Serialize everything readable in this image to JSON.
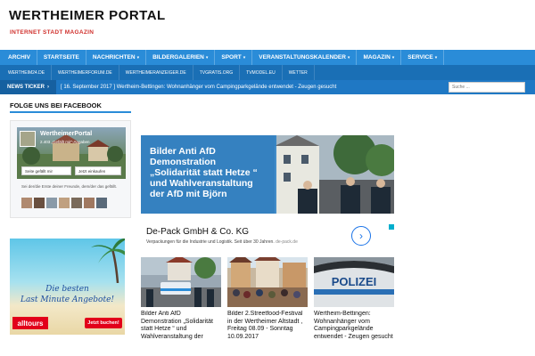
{
  "site": {
    "title": "WERTHEIMER PORTAL",
    "tagline": "INTERNET STADT MAGAZIN"
  },
  "main_nav": {
    "items": [
      {
        "label": "ARCHIV",
        "has_dropdown": false
      },
      {
        "label": "STARTSEITE",
        "has_dropdown": false
      },
      {
        "label": "NACHRICHTEN",
        "has_dropdown": true
      },
      {
        "label": "BILDERGALERIEN",
        "has_dropdown": true
      },
      {
        "label": "SPORT",
        "has_dropdown": true
      },
      {
        "label": "VERANSTALTUNGSKALENDER",
        "has_dropdown": true
      },
      {
        "label": "MAGAZIN",
        "has_dropdown": true
      },
      {
        "label": "SERVICE",
        "has_dropdown": true
      }
    ],
    "dropdown_icon": "chevron-down-icon"
  },
  "sub_nav": {
    "items": [
      "WERTHEIM24.DE",
      "WERTHEIMERFORUM.DE",
      "WERTHEIMERANZEIGER.DE",
      "TVGRATIS.ORG",
      "TVMODEL.EU",
      "WETTER"
    ]
  },
  "ticker": {
    "label": "NEWS TICKER",
    "arrow": "›",
    "date": "[ 16. September 2017 ]",
    "headline": "Wertheim-Bettingen: Wohnanhänger vom Campingparkgelände entwendet - Zeugen gesucht",
    "search_placeholder": "Suche ..."
  },
  "sidebar": {
    "facebook_title": "FOLGE UNS BEI FACEBOOK",
    "facebook": {
      "page_name": "WertheimerPortal",
      "likes_text": "2.403 „Gefällt mir“-Angaben",
      "like_button": "Seite gefällt mir",
      "share_button": "Jetzt einkaufen",
      "friends_text": "Sei der/die Erste deiner Freunde, dem/der das gefällt."
    },
    "ad": {
      "headline_line1": "Die besten",
      "headline_line2": "Last Minute Angebote!",
      "logo_text": "alltours",
      "cta_label": "Jetzt buchen!"
    }
  },
  "hero": {
    "caption": "Bilder Anti AfD Demonstration „Solidarität statt Hetze “ und Wahlveranstaltung der AfD mit Björn"
  },
  "text_ad": {
    "title": "De-Pack GmbH & Co. KG",
    "description": "Verpackungen für die Industrie und Logistik. Seit über 30 Jahren.",
    "url": "de-pack.de",
    "go_icon": "›"
  },
  "cards": [
    {
      "title": "Bilder Anti AfD Demonstration „Solidarität statt Hetze “ und Wahlveranstaltung der",
      "image": "police-demonstration-photo"
    },
    {
      "title": "Bilder 2.Streetfood-Festival in der Wertheimer Altstadt , Freitag 08.09 - Sonntag 10.09.2017",
      "image": "streetfood-festival-photo"
    },
    {
      "title": "Wertheim-Bettingen: Wohnanhänger vom Campingparkgelände entwendet - Zeugen gesucht",
      "image": "police-van-photo",
      "badge_text": "POLIZEI"
    }
  ],
  "colors": {
    "brand_blue": "#2a8cd8",
    "sub_nav_blue": "#1a6fb5",
    "ticker_blue": "#1f78c4",
    "tagline_red": "#d0312d",
    "ad_red": "#e2001a"
  }
}
